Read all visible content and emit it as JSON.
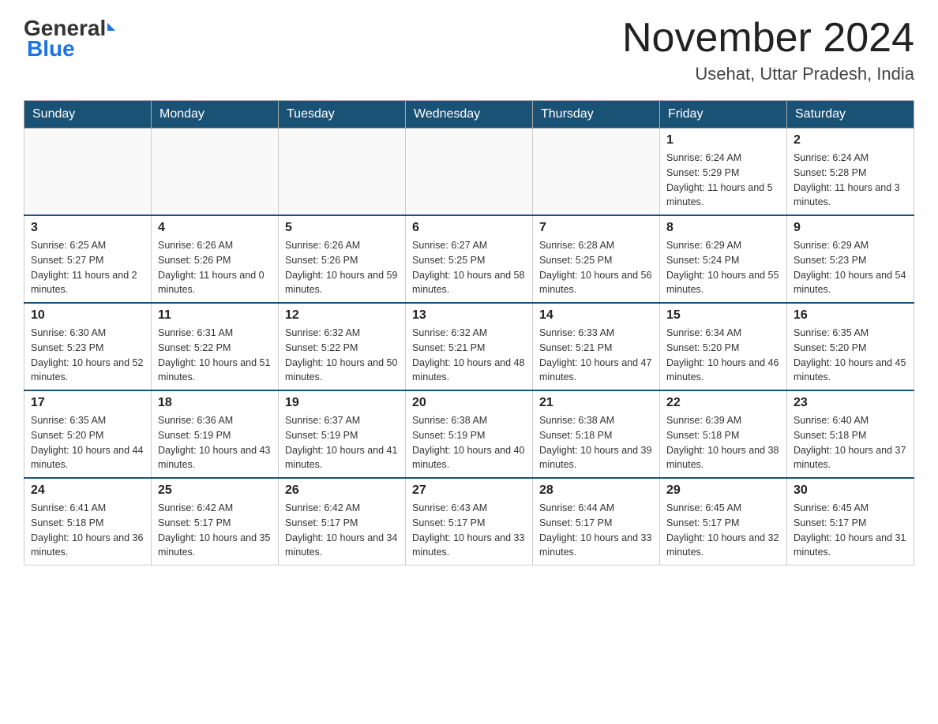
{
  "header": {
    "logo_general": "General",
    "logo_blue": "Blue",
    "title": "November 2024",
    "subtitle": "Usehat, Uttar Pradesh, India"
  },
  "weekdays": [
    "Sunday",
    "Monday",
    "Tuesday",
    "Wednesday",
    "Thursday",
    "Friday",
    "Saturday"
  ],
  "weeks": [
    [
      {
        "day": "",
        "info": ""
      },
      {
        "day": "",
        "info": ""
      },
      {
        "day": "",
        "info": ""
      },
      {
        "day": "",
        "info": ""
      },
      {
        "day": "",
        "info": ""
      },
      {
        "day": "1",
        "info": "Sunrise: 6:24 AM\nSunset: 5:29 PM\nDaylight: 11 hours and 5 minutes."
      },
      {
        "day": "2",
        "info": "Sunrise: 6:24 AM\nSunset: 5:28 PM\nDaylight: 11 hours and 3 minutes."
      }
    ],
    [
      {
        "day": "3",
        "info": "Sunrise: 6:25 AM\nSunset: 5:27 PM\nDaylight: 11 hours and 2 minutes."
      },
      {
        "day": "4",
        "info": "Sunrise: 6:26 AM\nSunset: 5:26 PM\nDaylight: 11 hours and 0 minutes."
      },
      {
        "day": "5",
        "info": "Sunrise: 6:26 AM\nSunset: 5:26 PM\nDaylight: 10 hours and 59 minutes."
      },
      {
        "day": "6",
        "info": "Sunrise: 6:27 AM\nSunset: 5:25 PM\nDaylight: 10 hours and 58 minutes."
      },
      {
        "day": "7",
        "info": "Sunrise: 6:28 AM\nSunset: 5:25 PM\nDaylight: 10 hours and 56 minutes."
      },
      {
        "day": "8",
        "info": "Sunrise: 6:29 AM\nSunset: 5:24 PM\nDaylight: 10 hours and 55 minutes."
      },
      {
        "day": "9",
        "info": "Sunrise: 6:29 AM\nSunset: 5:23 PM\nDaylight: 10 hours and 54 minutes."
      }
    ],
    [
      {
        "day": "10",
        "info": "Sunrise: 6:30 AM\nSunset: 5:23 PM\nDaylight: 10 hours and 52 minutes."
      },
      {
        "day": "11",
        "info": "Sunrise: 6:31 AM\nSunset: 5:22 PM\nDaylight: 10 hours and 51 minutes."
      },
      {
        "day": "12",
        "info": "Sunrise: 6:32 AM\nSunset: 5:22 PM\nDaylight: 10 hours and 50 minutes."
      },
      {
        "day": "13",
        "info": "Sunrise: 6:32 AM\nSunset: 5:21 PM\nDaylight: 10 hours and 48 minutes."
      },
      {
        "day": "14",
        "info": "Sunrise: 6:33 AM\nSunset: 5:21 PM\nDaylight: 10 hours and 47 minutes."
      },
      {
        "day": "15",
        "info": "Sunrise: 6:34 AM\nSunset: 5:20 PM\nDaylight: 10 hours and 46 minutes."
      },
      {
        "day": "16",
        "info": "Sunrise: 6:35 AM\nSunset: 5:20 PM\nDaylight: 10 hours and 45 minutes."
      }
    ],
    [
      {
        "day": "17",
        "info": "Sunrise: 6:35 AM\nSunset: 5:20 PM\nDaylight: 10 hours and 44 minutes."
      },
      {
        "day": "18",
        "info": "Sunrise: 6:36 AM\nSunset: 5:19 PM\nDaylight: 10 hours and 43 minutes."
      },
      {
        "day": "19",
        "info": "Sunrise: 6:37 AM\nSunset: 5:19 PM\nDaylight: 10 hours and 41 minutes."
      },
      {
        "day": "20",
        "info": "Sunrise: 6:38 AM\nSunset: 5:19 PM\nDaylight: 10 hours and 40 minutes."
      },
      {
        "day": "21",
        "info": "Sunrise: 6:38 AM\nSunset: 5:18 PM\nDaylight: 10 hours and 39 minutes."
      },
      {
        "day": "22",
        "info": "Sunrise: 6:39 AM\nSunset: 5:18 PM\nDaylight: 10 hours and 38 minutes."
      },
      {
        "day": "23",
        "info": "Sunrise: 6:40 AM\nSunset: 5:18 PM\nDaylight: 10 hours and 37 minutes."
      }
    ],
    [
      {
        "day": "24",
        "info": "Sunrise: 6:41 AM\nSunset: 5:18 PM\nDaylight: 10 hours and 36 minutes."
      },
      {
        "day": "25",
        "info": "Sunrise: 6:42 AM\nSunset: 5:17 PM\nDaylight: 10 hours and 35 minutes."
      },
      {
        "day": "26",
        "info": "Sunrise: 6:42 AM\nSunset: 5:17 PM\nDaylight: 10 hours and 34 minutes."
      },
      {
        "day": "27",
        "info": "Sunrise: 6:43 AM\nSunset: 5:17 PM\nDaylight: 10 hours and 33 minutes."
      },
      {
        "day": "28",
        "info": "Sunrise: 6:44 AM\nSunset: 5:17 PM\nDaylight: 10 hours and 33 minutes."
      },
      {
        "day": "29",
        "info": "Sunrise: 6:45 AM\nSunset: 5:17 PM\nDaylight: 10 hours and 32 minutes."
      },
      {
        "day": "30",
        "info": "Sunrise: 6:45 AM\nSunset: 5:17 PM\nDaylight: 10 hours and 31 minutes."
      }
    ]
  ]
}
